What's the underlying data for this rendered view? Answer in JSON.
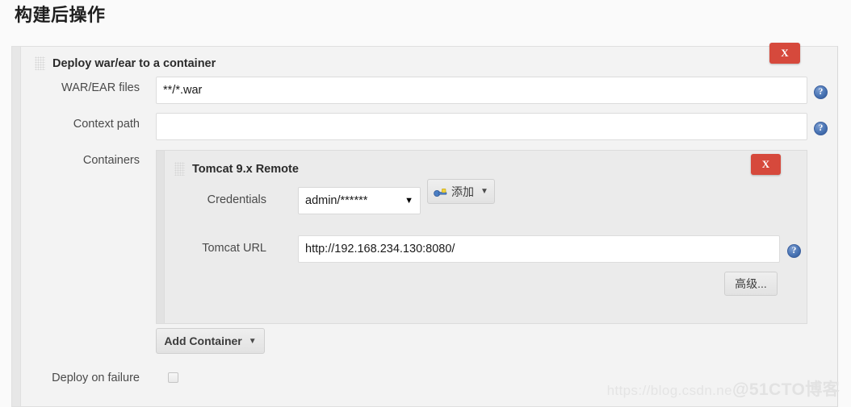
{
  "page": {
    "title": "构建后操作"
  },
  "post_build": {
    "section_title": "Deploy war/ear to a container",
    "delete_label": "X",
    "fields": {
      "war_label": "WAR/EAR files",
      "war_value": "**/*.war",
      "war_placeholder": "",
      "context_label": "Context path",
      "context_value": "",
      "context_placeholder": "",
      "containers_label": "Containers"
    },
    "container": {
      "title": "Tomcat 9.x Remote",
      "delete_label": "X",
      "credentials_label": "Credentials",
      "credentials_value": "admin/******",
      "credentials_caret": "▼",
      "add_credentials_label": "添加",
      "add_credentials_caret": "▼",
      "tomcat_url_label": "Tomcat URL",
      "tomcat_url_value": "http://192.168.234.130:8080/",
      "tomcat_url_placeholder": "",
      "advanced_label": "高级..."
    },
    "add_container_label": "Add Container",
    "add_container_caret": "▼",
    "deploy_on_failure_label": "Deploy on failure",
    "help_symbol": "?"
  },
  "watermark": {
    "text_left": "https://blog.csdn.ne",
    "text_right": "@51CTO博客"
  }
}
